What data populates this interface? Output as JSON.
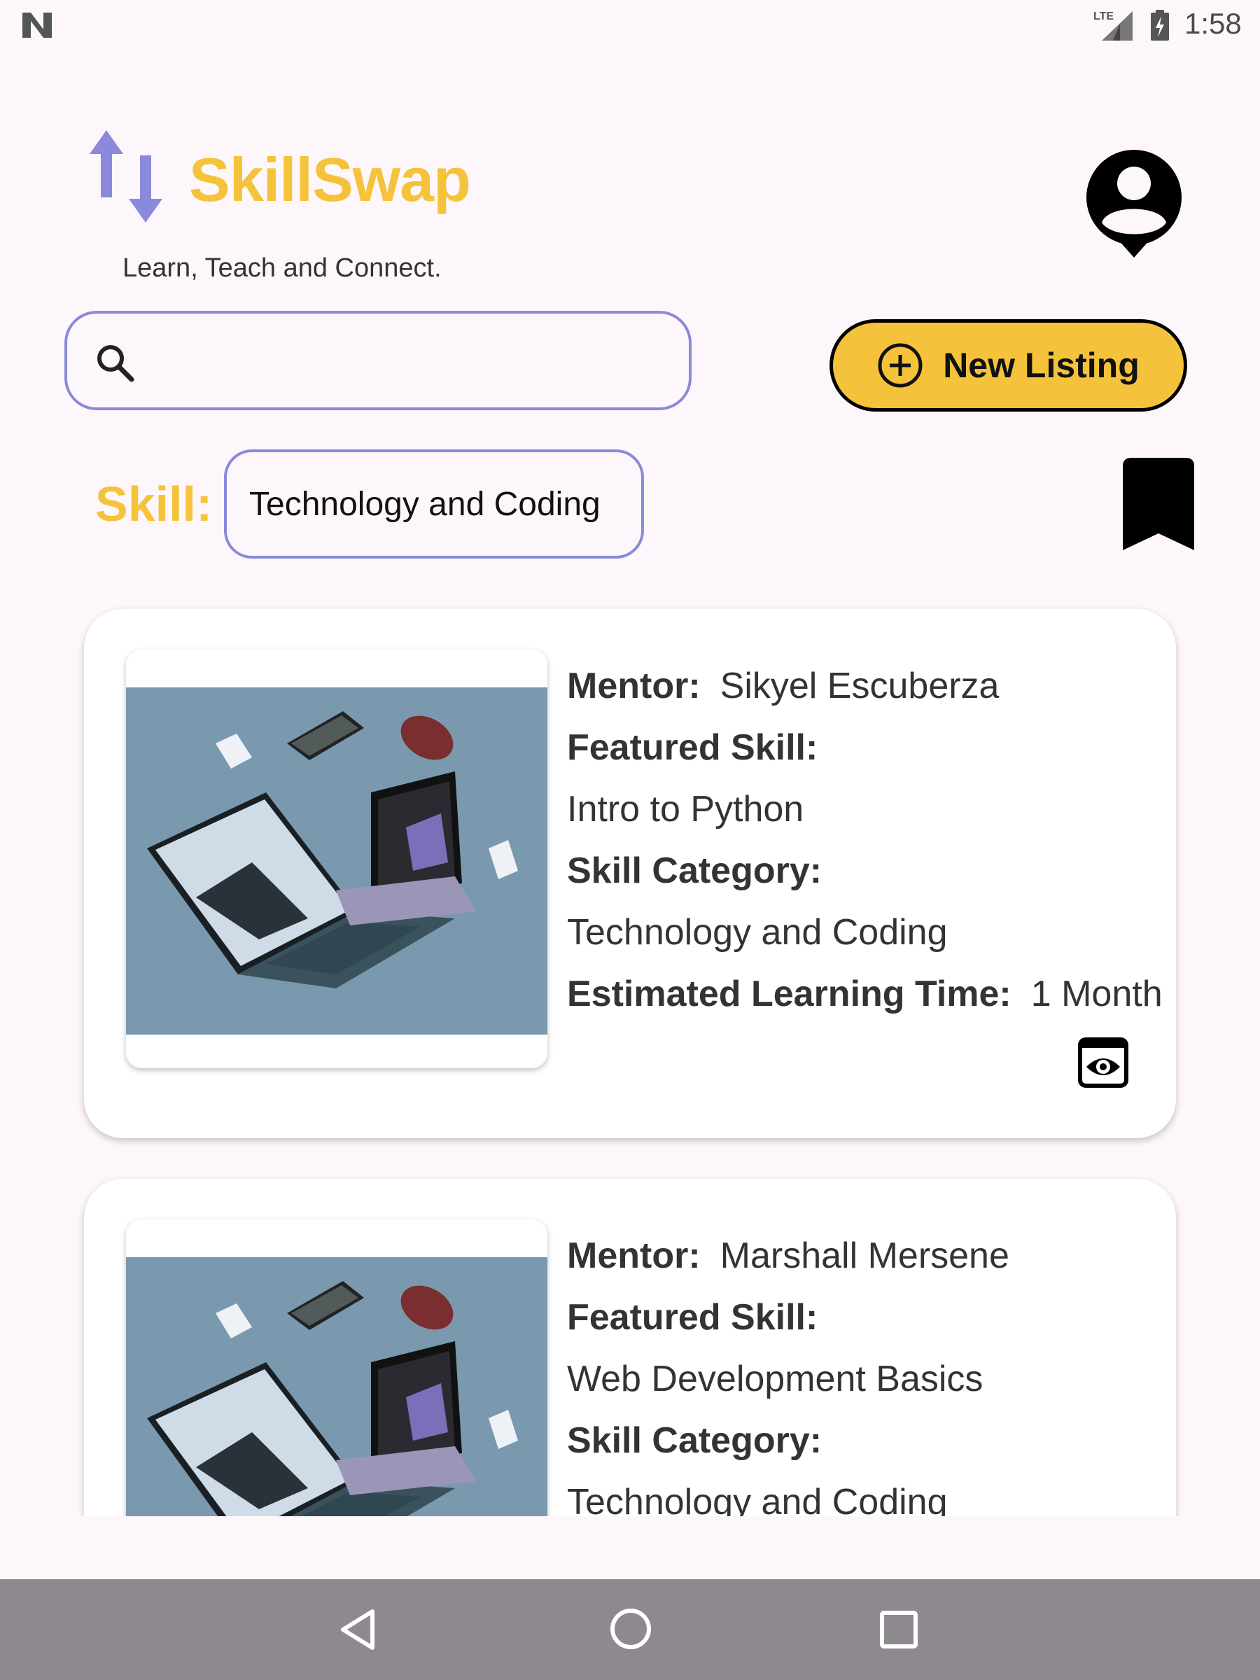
{
  "status_bar": {
    "time": "1:58",
    "network": "LTE"
  },
  "header": {
    "app_title": "SkillSwap",
    "tagline": "Learn, Teach and Connect."
  },
  "search": {
    "placeholder": "",
    "value": ""
  },
  "new_listing": {
    "label": "New Listing"
  },
  "filter": {
    "skill_label": "Skill:",
    "selected_skill": "Technology and Coding"
  },
  "labels": {
    "mentor": "Mentor:",
    "featured_skill": "Featured Skill:",
    "skill_category": "Skill Category:",
    "estimated_time": "Estimated Learning Time:"
  },
  "listings": [
    {
      "mentor": "Sikyel Escuberza",
      "featured_skill": "Intro to Python",
      "skill_category": "Technology and Coding",
      "estimated_time": "1 Month"
    },
    {
      "mentor": "Marshall Mersene",
      "featured_skill": "Web Development Basics",
      "skill_category": "Technology and Coding"
    }
  ],
  "colors": {
    "accent_yellow": "#f5c33b",
    "accent_purple": "#8a89db",
    "background": "#fdf7fc",
    "nav_bar": "#8e898f"
  },
  "icons": {
    "logo": "swap-arrows-icon",
    "profile": "account-circle-icon",
    "search": "search-icon",
    "new_listing": "plus-circle-icon",
    "bookmark": "bookmark-icon",
    "view": "eye-icon",
    "nav_back": "back-triangle-icon",
    "nav_home": "home-circle-icon",
    "nav_recent": "recent-square-icon"
  }
}
